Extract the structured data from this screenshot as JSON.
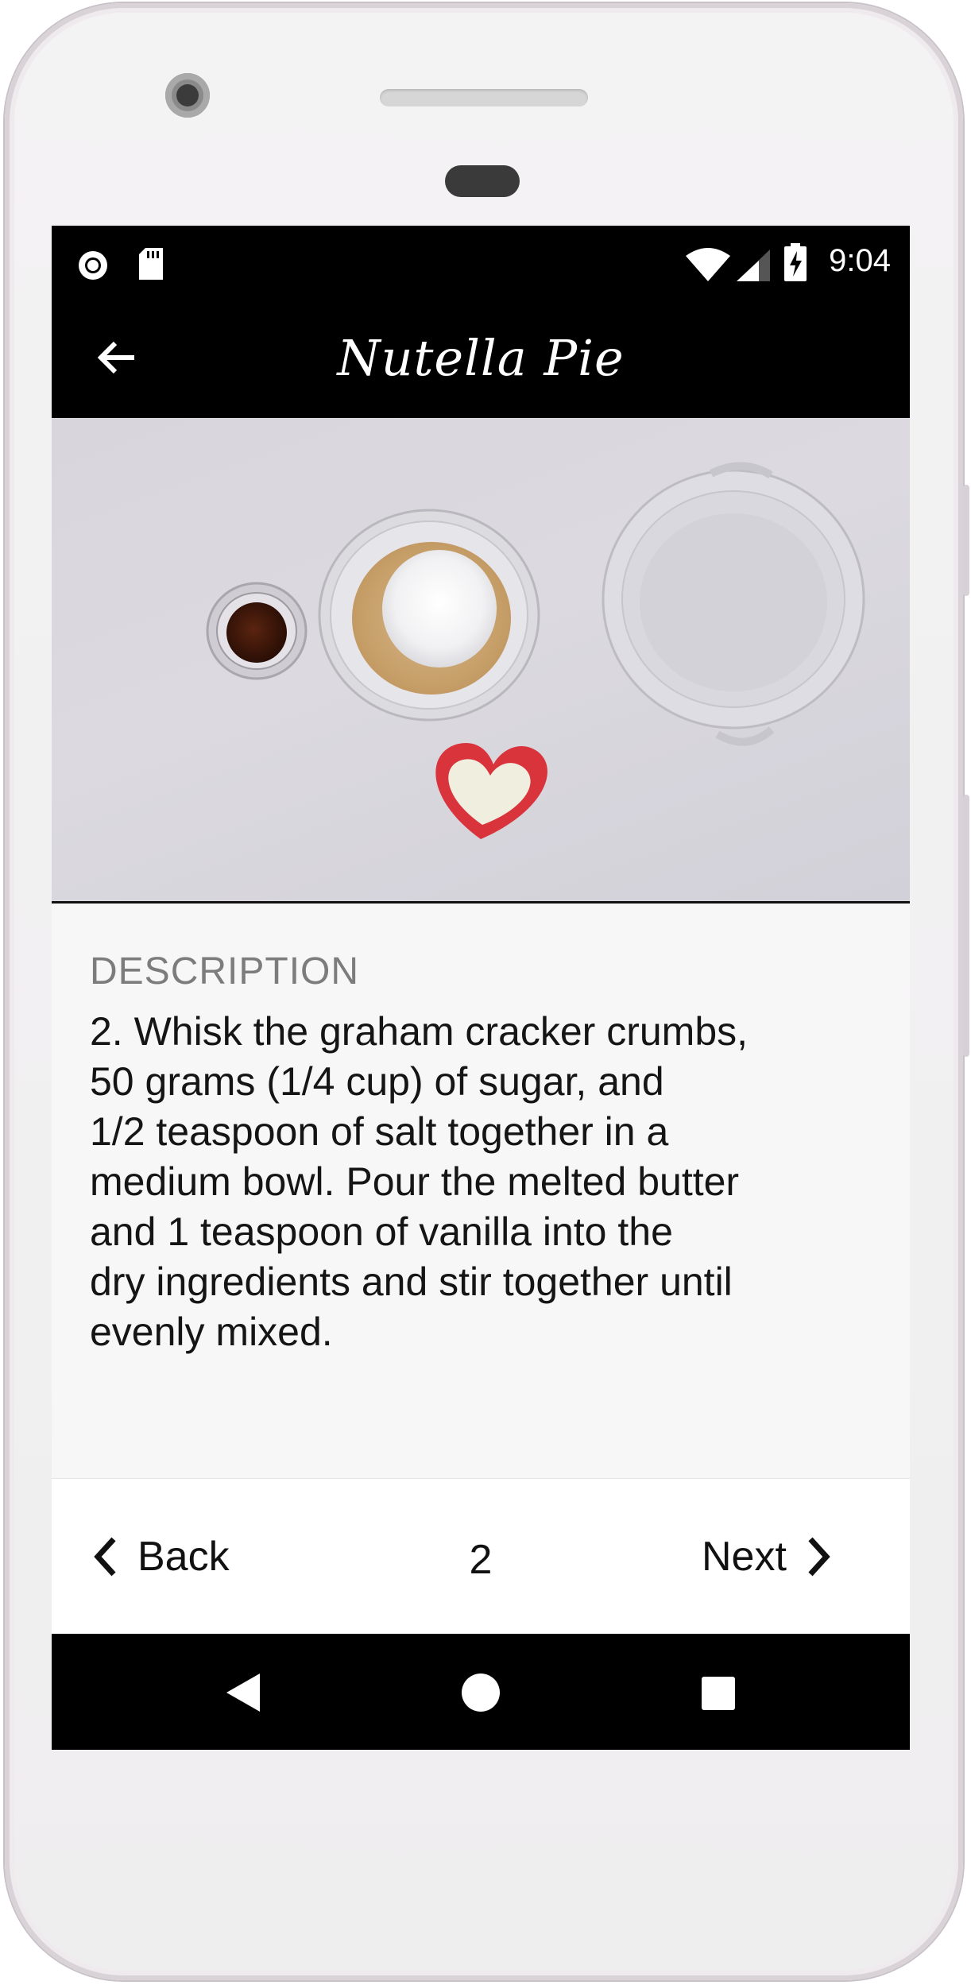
{
  "status_bar": {
    "time": "9:04",
    "left_icons": [
      "record-icon",
      "sd-card-icon"
    ],
    "right_icons": [
      "wifi-icon",
      "signal-icon",
      "battery-charging-icon"
    ]
  },
  "toolbar": {
    "title": "Nutella Pie",
    "back_icon": "arrow-back-icon"
  },
  "media": {
    "content": "step-image"
  },
  "description": {
    "label": "DESCRIPTION",
    "text": "2. Whisk the graham cracker crumbs,\n50 grams (1/4 cup) of sugar, and\n1/2 teaspoon of salt together in a\nmedium bowl. Pour the melted butter\nand 1 teaspoon of vanilla into the\ndry ingredients and stir together until\nevenly mixed."
  },
  "step_nav": {
    "back_label": "Back",
    "next_label": "Next",
    "page": "2"
  },
  "system_nav": {
    "icons": [
      "nav-back-icon",
      "nav-home-icon",
      "nav-recents-icon"
    ]
  },
  "colors": {
    "bar": "#000000",
    "screen_bg": "#f7f7f7",
    "label_gray": "#7c7c7c",
    "heart_red": "#d9333c"
  }
}
